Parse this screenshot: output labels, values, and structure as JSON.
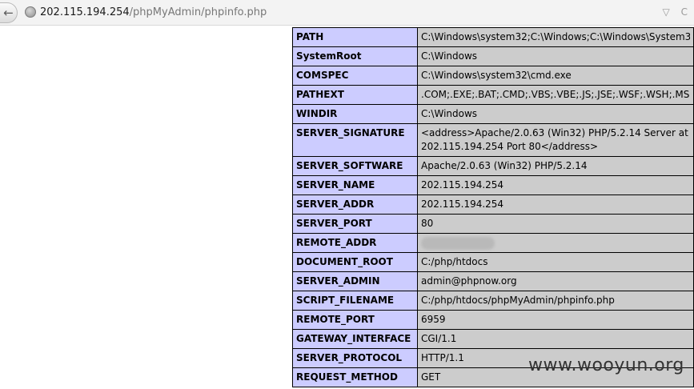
{
  "address_bar": {
    "host": "202.115.194.254",
    "path": "/phpMyAdmin/phpinfo.php",
    "back_glyph": "←",
    "dropdown_glyph": "▽",
    "reload_glyph": "C"
  },
  "env_rows": [
    {
      "key": "PATH",
      "value": "C:\\Windows\\system32;C:\\Windows;C:\\Windows\\System32"
    },
    {
      "key": "SystemRoot",
      "value": "C:\\Windows"
    },
    {
      "key": "COMSPEC",
      "value": "C:\\Windows\\system32\\cmd.exe"
    },
    {
      "key": "PATHEXT",
      "value": ".COM;.EXE;.BAT;.CMD;.VBS;.VBE;.JS;.JSE;.WSF;.WSH;.MSC"
    },
    {
      "key": "WINDIR",
      "value": "C:\\Windows"
    },
    {
      "key": "SERVER_SIGNATURE",
      "value": "<address>Apache/2.0.63 (Win32) PHP/5.2.14 Server at 202.115.194.254 Port 80</address>",
      "wrap": true
    },
    {
      "key": "SERVER_SOFTWARE",
      "value": "Apache/2.0.63 (Win32) PHP/5.2.14"
    },
    {
      "key": "SERVER_NAME",
      "value": "202.115.194.254"
    },
    {
      "key": "SERVER_ADDR",
      "value": "202.115.194.254"
    },
    {
      "key": "SERVER_PORT",
      "value": "80"
    },
    {
      "key": "REMOTE_ADDR",
      "value": "",
      "redacted": true
    },
    {
      "key": "DOCUMENT_ROOT",
      "value": "C:/php/htdocs"
    },
    {
      "key": "SERVER_ADMIN",
      "value": "admin@phpnow.org"
    },
    {
      "key": "SCRIPT_FILENAME",
      "value": "C:/php/htdocs/phpMyAdmin/phpinfo.php"
    },
    {
      "key": "REMOTE_PORT",
      "value": "6959"
    },
    {
      "key": "GATEWAY_INTERFACE",
      "value": "CGI/1.1"
    },
    {
      "key": "SERVER_PROTOCOL",
      "value": "HTTP/1.1"
    },
    {
      "key": "REQUEST_METHOD",
      "value": "GET"
    }
  ],
  "watermark": "www.wooyun.org",
  "colors": {
    "key_bg": "#ccccff",
    "value_bg": "#cccccc"
  }
}
